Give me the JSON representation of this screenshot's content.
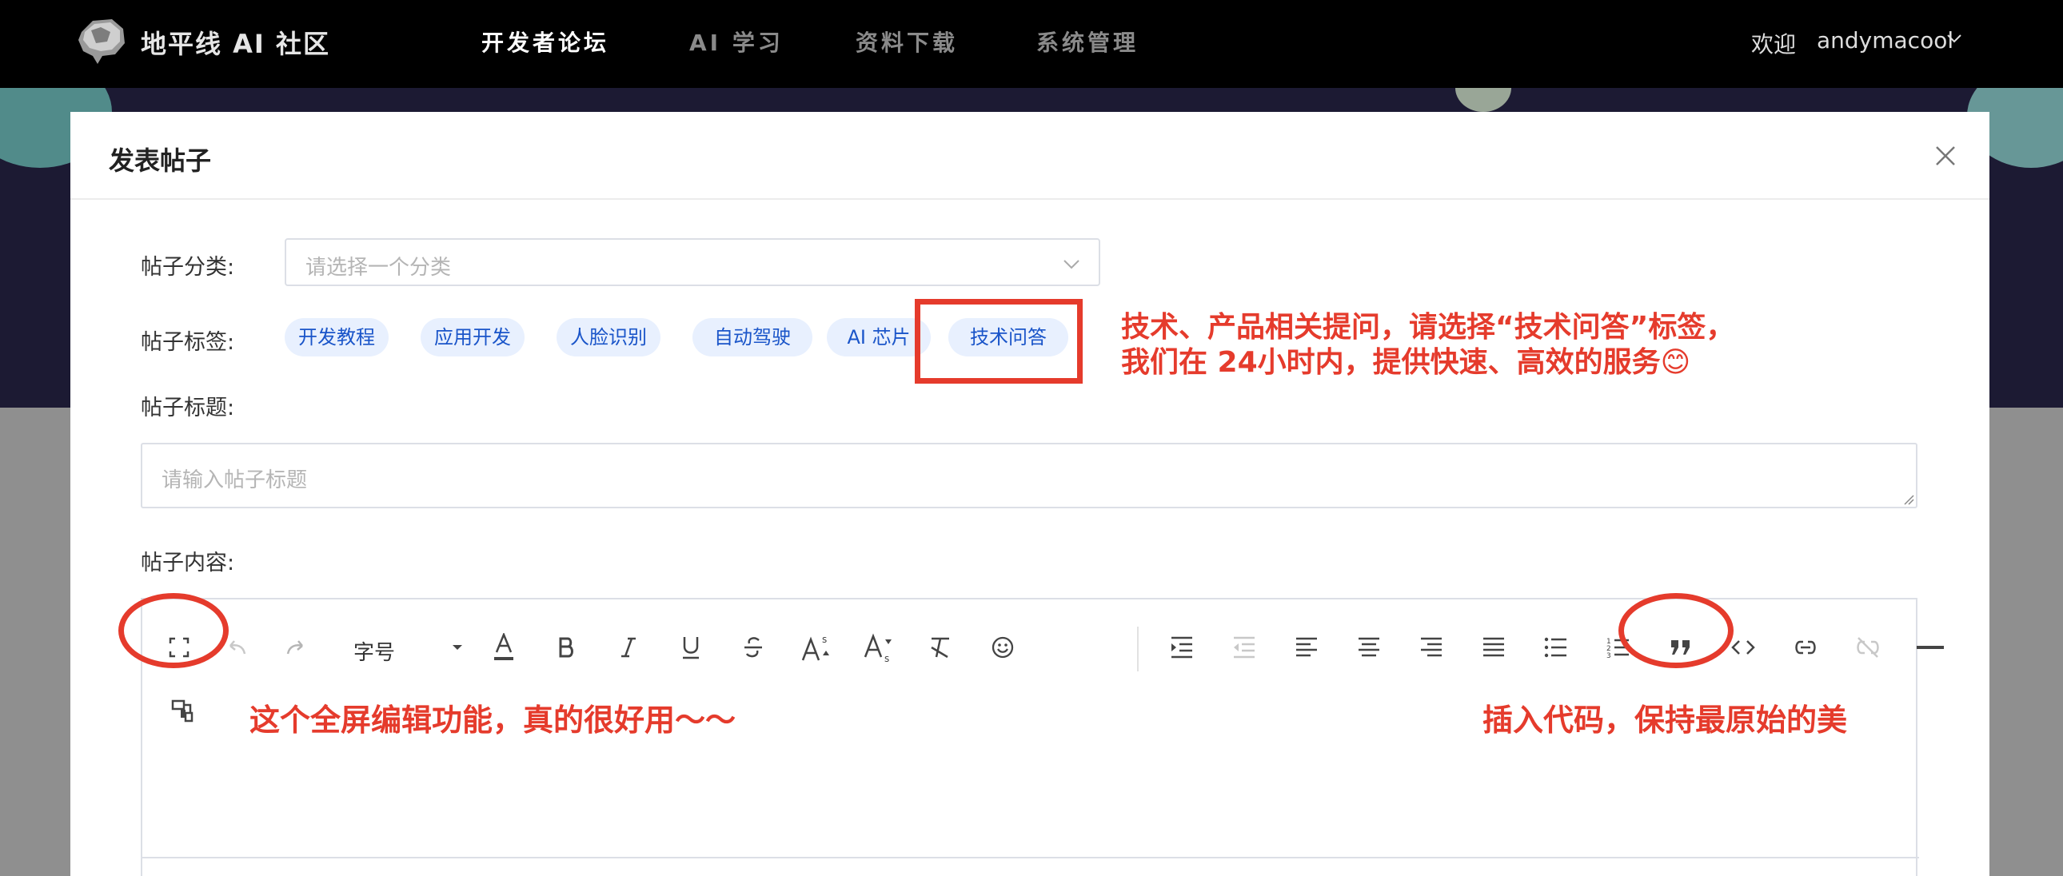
{
  "header": {
    "brand": "地平线 AI 社区",
    "nav": [
      "开发者论坛",
      "AI 学习",
      "资料下载",
      "系统管理"
    ],
    "welcome": "欢迎",
    "username": "andymacool"
  },
  "modal": {
    "title": "发表帖子",
    "category_label": "帖子分类:",
    "category_placeholder": "请选择一个分类",
    "tags_label": "帖子标签:",
    "tags": [
      "开发教程",
      "应用开发",
      "人脸识别",
      "自动驾驶",
      "AI 芯片",
      "技术问答"
    ],
    "title_label": "帖子标题:",
    "title_placeholder": "请输入帖子标题",
    "content_label": "帖子内容:",
    "font_size_label": "字号"
  },
  "annotations": {
    "tag_note_line1": "技术、产品相关提问，请选择“技术问答”标签，",
    "tag_note_line2": "我们在 24小时内，提供快速、高效的服务😊",
    "fullscreen_note": "这个全屏编辑功能，真的很好用～～",
    "code_note": "插入代码，保持最原始的美"
  },
  "icons": {
    "toolbar": [
      "fullscreen-icon",
      "undo-icon",
      "redo-icon",
      "font-color-icon",
      "bold-icon",
      "italic-icon",
      "underline-icon",
      "strikethrough-icon",
      "superscript-icon",
      "subscript-icon",
      "clear-format-icon",
      "emoji-icon",
      "indent-icon",
      "outdent-icon",
      "align-left-icon",
      "align-center-icon",
      "align-right-icon",
      "align-justify-icon",
      "bullet-list-icon",
      "numbered-list-icon",
      "quote-icon",
      "code-icon",
      "link-icon",
      "unlink-icon",
      "horizontal-rule-icon",
      "format-painter-icon"
    ]
  },
  "colors": {
    "annotation": "#e53b2c",
    "tag_bg": "#e8f0fe",
    "tag_text": "#1a55c9",
    "topbar": "#000000"
  }
}
